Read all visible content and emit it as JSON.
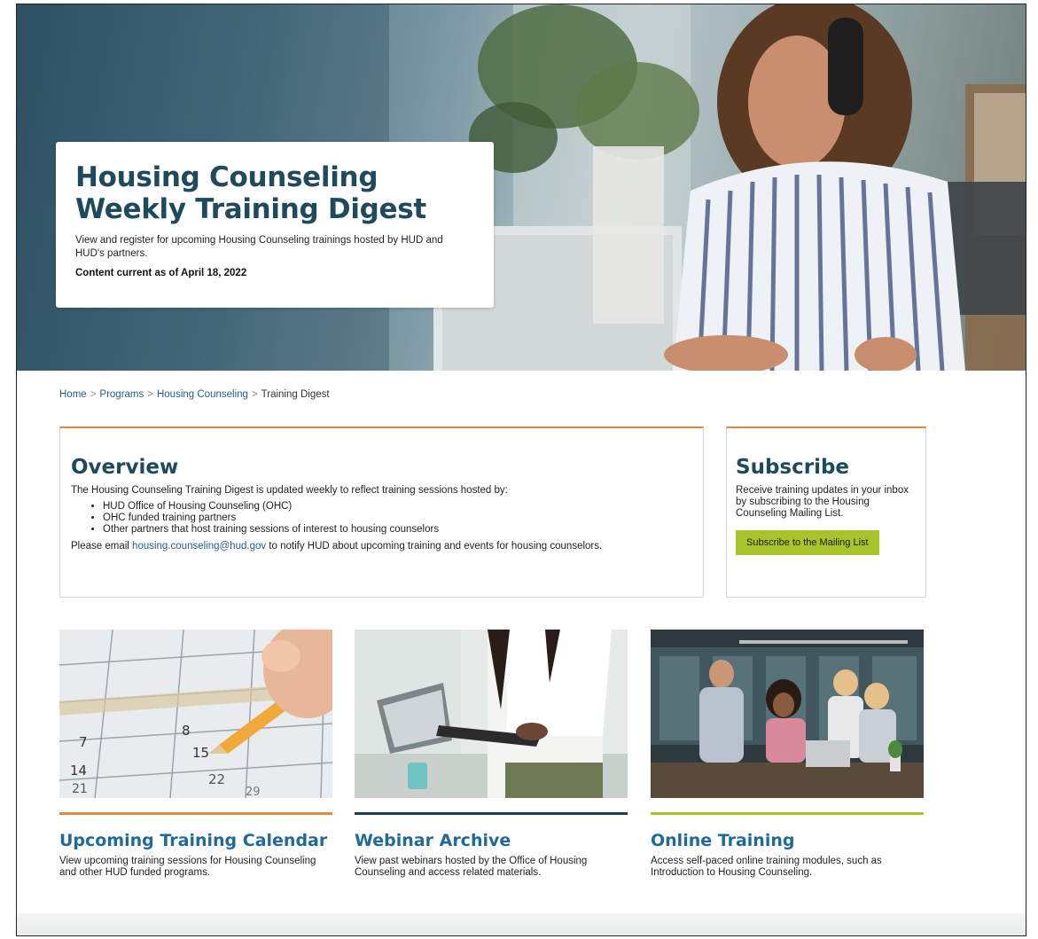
{
  "hero": {
    "title_line1": "Housing Counseling",
    "title_line2": "Weekly Training Digest",
    "description": "View and register for upcoming Housing Counseling trainings hosted by HUD and HUD's partners.",
    "date": "Content current as of April 18, 2022"
  },
  "breadcrumb": {
    "home": "Home",
    "programs": "Programs",
    "housing_counseling": "Housing Counseling",
    "current": "Training Digest",
    "separator": ">"
  },
  "overview": {
    "title": "Overview",
    "intro": "The Housing Counseling Training Digest is updated weekly to reflect training sessions hosted by:",
    "items": [
      "HUD Office of Housing Counseling (OHC)",
      "OHC funded training partners",
      "Other partners that host training sessions of interest to housing counselors"
    ],
    "email_prefix": "Please email ",
    "email": "housing.counseling@hud.gov",
    "email_suffix": " to notify HUD about upcoming training and events for housing counselors."
  },
  "subscribe": {
    "title": "Subscribe",
    "description": "Receive training updates in your inbox by subscribing to the Housing Counseling Mailing List.",
    "button": "Subscribe to the Mailing List"
  },
  "cards": [
    {
      "title": "Upcoming Training Calendar",
      "description": "View upcoming training sessions for Housing Counseling and other HUD funded programs.",
      "accent": "#e08a3c",
      "calendar_numbers": [
        "7",
        "8",
        "14",
        "15",
        "21",
        "22",
        "29"
      ]
    },
    {
      "title": "Webinar Archive",
      "description": "View past webinars hosted by the Office of Housing Counseling and access related materials.",
      "accent": "#1f3f52"
    },
    {
      "title": "Online Training",
      "description": "Access self-paced online training modules, such as Introduction to Housing Counseling.",
      "accent": "#a9c42b"
    }
  ],
  "colors": {
    "heading": "#1f4a5c",
    "link": "#1f5f8b",
    "card_title": "#1f6a9a",
    "panel_accent": "#e08a3c",
    "button": "#a9c42b"
  }
}
